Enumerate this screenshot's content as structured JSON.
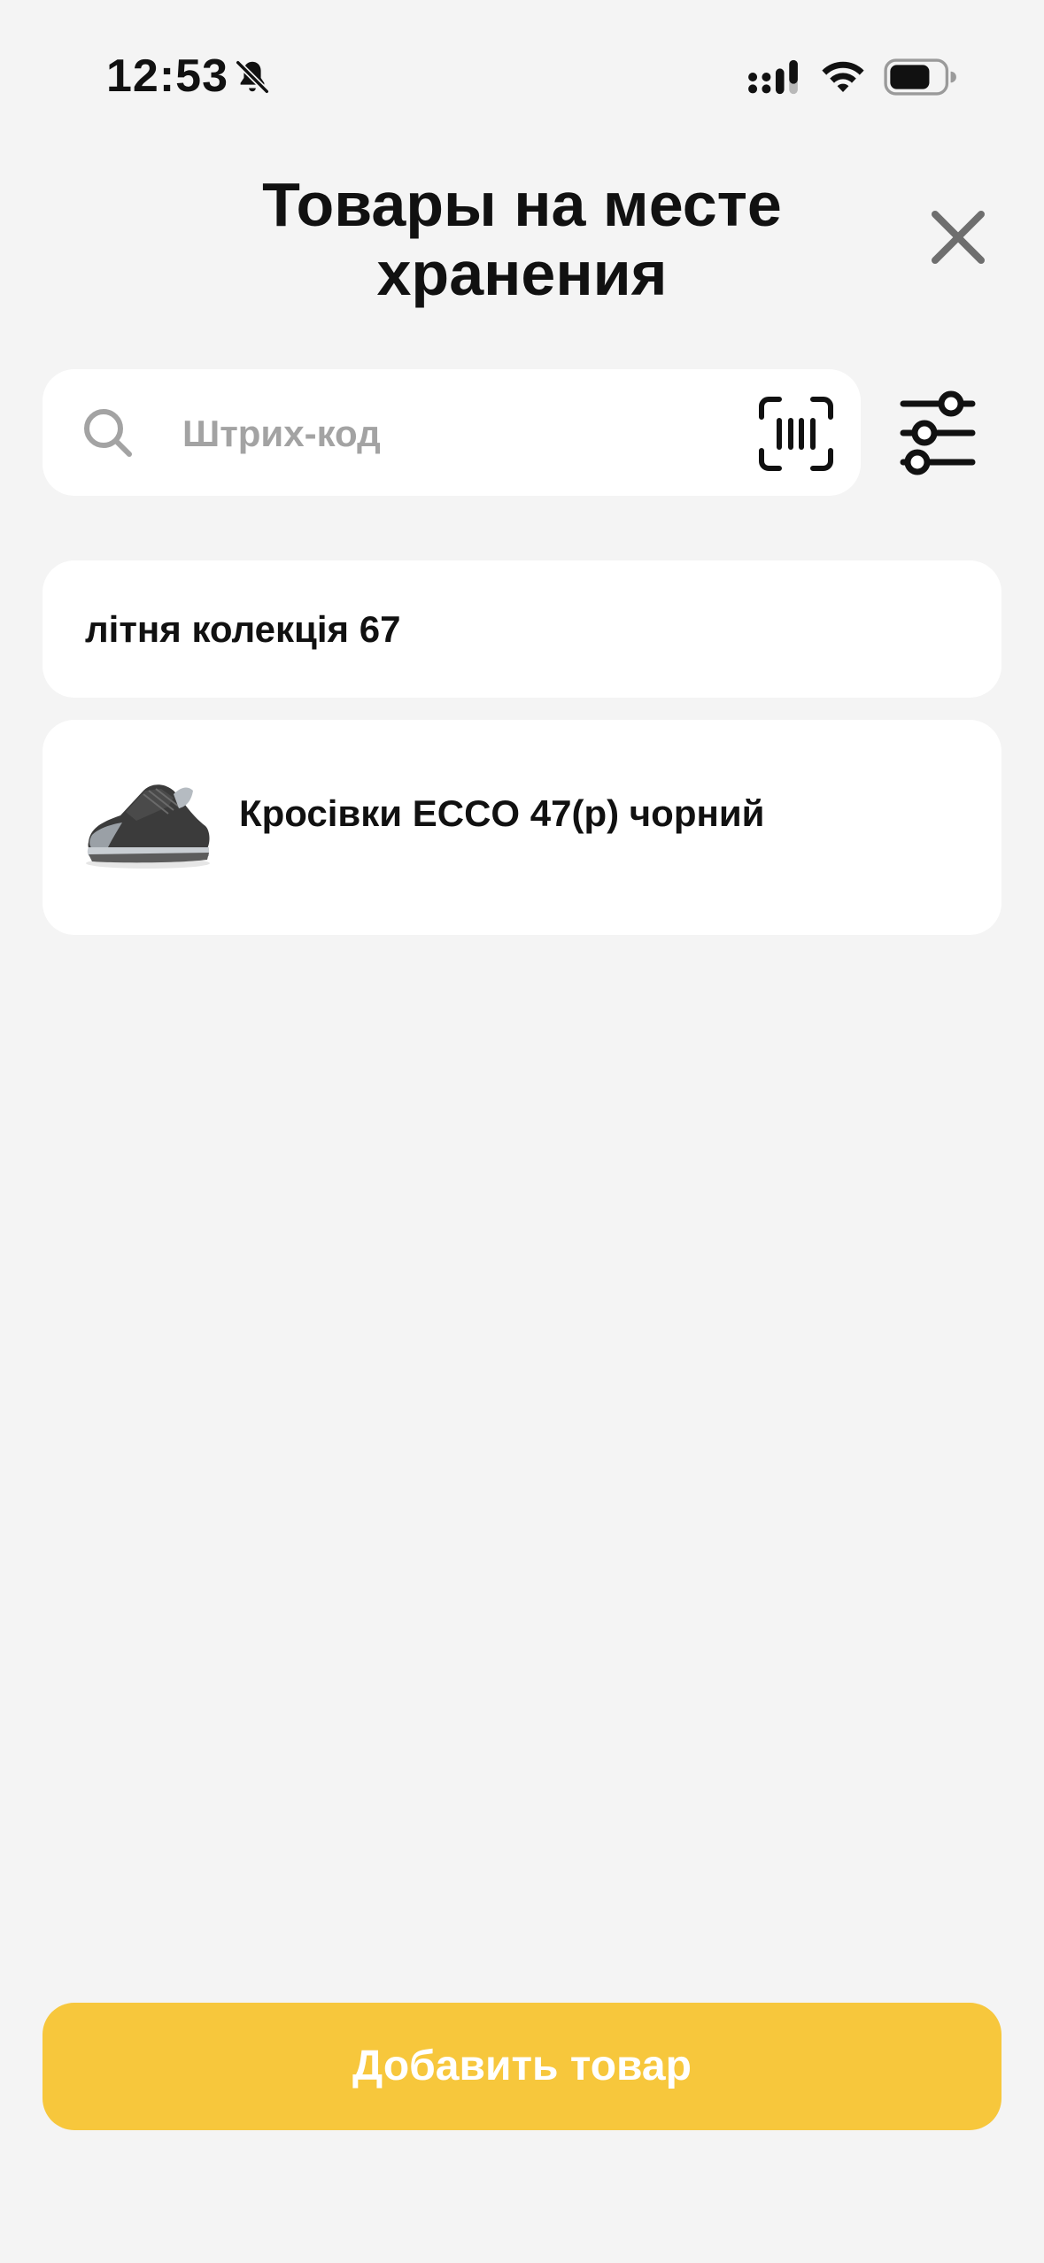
{
  "status_bar": {
    "time": "12:53",
    "icons": [
      "bell-off-icon",
      "signal-icon",
      "wifi-icon",
      "battery-icon"
    ]
  },
  "header": {
    "title": "Товары на месте хранения",
    "close_icon": "close-icon"
  },
  "search": {
    "placeholder": "Штрих-код",
    "value": "",
    "icon": "search-icon",
    "scan_icon": "barcode-scan-icon",
    "filter_icon": "filter-sliders-icon"
  },
  "list": {
    "group": {
      "label": "літня колекція 67"
    },
    "products": [
      {
        "name": "Кросівки ECCO 47(р) чорний",
        "thumbnail": "sneaker-image"
      }
    ]
  },
  "footer": {
    "add_button_label": "Добавить товар"
  },
  "colors": {
    "background": "#f4f4f4",
    "card": "#ffffff",
    "accent": "#f7c73c",
    "placeholder": "#a3a3a3",
    "icon_gray": "#6e6e6e"
  }
}
